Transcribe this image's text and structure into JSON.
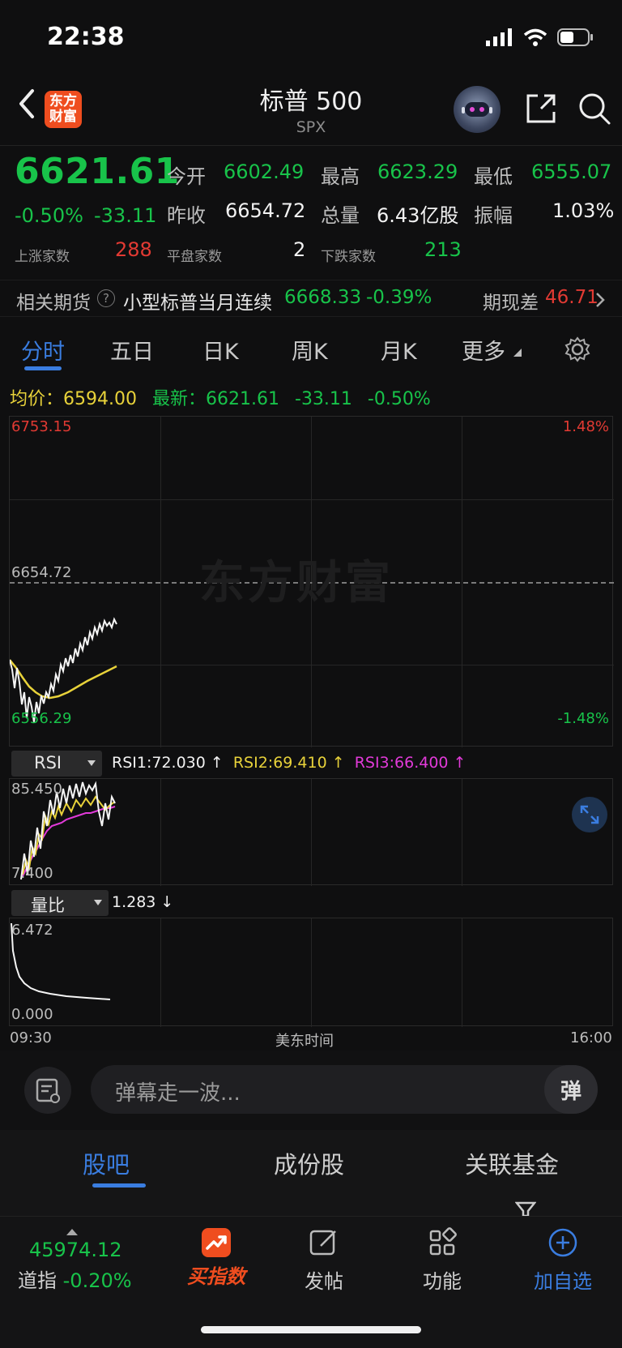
{
  "status_bar": {
    "time": "22:38"
  },
  "header": {
    "logo_line1": "东方",
    "logo_line2": "财富",
    "title": "标普 500",
    "subtitle": "SPX"
  },
  "quote": {
    "price": "6621.61",
    "change_pct": "-0.50%",
    "change": "-33.11",
    "open_label": "今开",
    "open": "6602.49",
    "high_label": "最高",
    "high": "6623.29",
    "low_label": "最低",
    "low": "6555.07",
    "prev_close_label": "昨收",
    "prev_close": "6654.72",
    "volume_label": "总量",
    "volume": "6.43亿股",
    "amplitude_label": "振幅",
    "amplitude": "1.03%",
    "up_count_label": "上涨家数",
    "up_count": "288",
    "flat_count_label": "平盘家数",
    "flat_count": "2",
    "down_count_label": "下跌家数",
    "down_count": "213"
  },
  "futures": {
    "label": "相关期货",
    "name": "小型标普当月连续",
    "value": "6668.33",
    "pct": "-0.39%",
    "basis_label": "期现差",
    "basis": "46.71"
  },
  "chart_tabs": [
    "分时",
    "五日",
    "日K",
    "周K",
    "月K",
    "更多"
  ],
  "chart_info": {
    "avg_label": "均价：",
    "avg": "6594.00",
    "latest_label": "最新：",
    "latest": "6621.61",
    "latest_change": "-33.11",
    "latest_pct": "-0.50%"
  },
  "main_chart": {
    "y_top": "6753.15",
    "y_mid": "6654.72",
    "y_bottom": "6556.29",
    "pct_top": "1.48%",
    "pct_bottom": "-1.48%",
    "watermark": "东方财富",
    "x_start": "09:30",
    "x_mid": "美东时间",
    "x_end": "16:00"
  },
  "rsi_panel": {
    "select": "RSI",
    "rsi1": "RSI1:72.030 ↑",
    "rsi2": "RSI2:69.410 ↑",
    "rsi3": "RSI3:66.400 ↑",
    "y_top": "85.450",
    "y_bottom": "7.400"
  },
  "vol_panel": {
    "select": "量比",
    "value": "1.283 ↓",
    "y_top": "6.472",
    "y_bottom": "0.000"
  },
  "danmu": {
    "placeholder": "弹幕走一波...",
    "toggle": "弹"
  },
  "section_tabs": [
    "股吧",
    "成份股",
    "关联基金"
  ],
  "bottom_nav": {
    "index_value": "45974.12",
    "index_name": "道指",
    "index_pct": "-0.20%",
    "buy_label": "买指数",
    "post_label": "发帖",
    "function_label": "功能",
    "watchlist_label": "加自选"
  },
  "colors": {
    "up": "#e23a33",
    "down": "#18c34a",
    "accent": "#3a7de0",
    "avg_line": "#e8d23a"
  }
}
